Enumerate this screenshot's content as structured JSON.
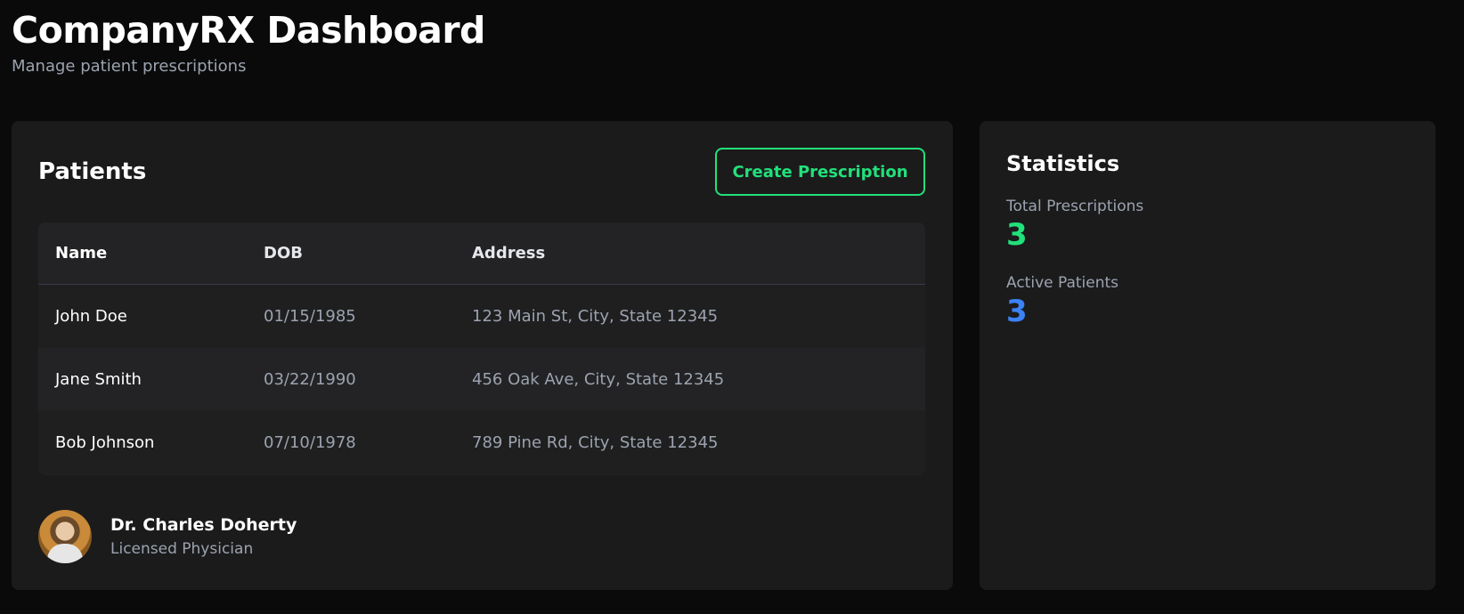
{
  "header": {
    "title": "CompanyRX Dashboard",
    "subtitle": "Manage patient prescriptions"
  },
  "patients": {
    "title": "Patients",
    "create_button": "Create Prescription",
    "columns": [
      "Name",
      "DOB",
      "Address"
    ],
    "rows": [
      {
        "name": "John Doe",
        "dob": "01/15/1985",
        "address": "123 Main St, City, State 12345"
      },
      {
        "name": "Jane Smith",
        "dob": "03/22/1990",
        "address": "456 Oak Ave, City, State 12345"
      },
      {
        "name": "Bob Johnson",
        "dob": "07/10/1978",
        "address": "789 Pine Rd, City, State 12345"
      }
    ]
  },
  "doctor": {
    "name": "Dr. Charles Doherty",
    "role": "Licensed Physician"
  },
  "statistics": {
    "title": "Statistics",
    "items": [
      {
        "label": "Total Prescriptions",
        "value": "3",
        "color": "#22e07a"
      },
      {
        "label": "Active Patients",
        "value": "3",
        "color": "#3b82f6"
      }
    ]
  },
  "colors": {
    "accent_green": "#22e07a",
    "accent_blue": "#3b82f6",
    "background": "#0a0a0a",
    "card": "#1b1b1c"
  }
}
